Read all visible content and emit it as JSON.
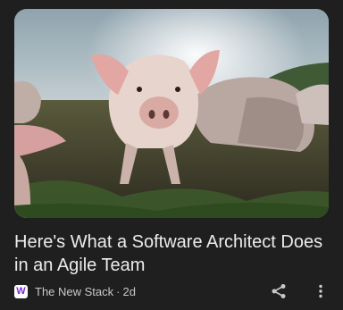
{
  "article": {
    "image_alt_icon": "article-photo",
    "headline": "Here's What a Software Architect Does in an Agile Team",
    "source_logo_letter": "W",
    "source_name": "The New Stack",
    "separator": "·",
    "age": "2d"
  },
  "actions": {
    "share_icon": "share-icon",
    "more_icon": "more-vert-icon"
  },
  "colors": {
    "background": "#1f1f1f",
    "headline_text": "#ececec",
    "meta_text": "#c9c9c9",
    "source_logo_accent": "#7b2bd8"
  }
}
